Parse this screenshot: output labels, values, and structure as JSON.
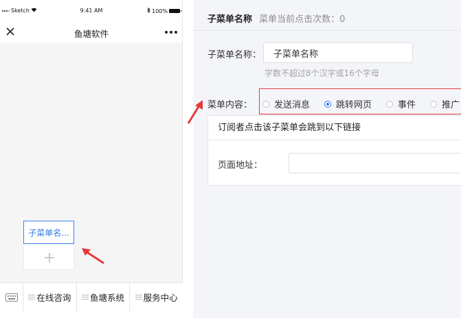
{
  "phone": {
    "status": {
      "carrier": "Sketch",
      "time": "9:41 AM",
      "battery": "100%"
    },
    "nav_title": "鱼塘软件",
    "submenu_item": "子菜单名...",
    "menus": [
      "在线咨询",
      "鱼塘系统",
      "服务中心"
    ]
  },
  "editor": {
    "header_title": "子菜单名称",
    "header_count": "菜单当前点击次数：0",
    "name_label": "子菜单名称：",
    "name_value": "子菜单名称",
    "name_hint": "字数不超过8个汉字或16个字母",
    "content_label": "菜单内容：",
    "options": [
      {
        "label": "发送消息",
        "selected": false
      },
      {
        "label": "跳转网页",
        "selected": true
      },
      {
        "label": "事件",
        "selected": false
      },
      {
        "label": "推广",
        "selected": false
      }
    ],
    "link_card_title": "订阅者点击该子菜单会跳到以下链接",
    "url_label": "页面地址：",
    "url_value": ""
  },
  "colors": {
    "accent": "#2f7ae5",
    "highlight": "#e4393c",
    "panel_bg": "#f4f5f9"
  },
  "icons": [
    "close-icon",
    "more-icon",
    "wifi-icon",
    "bluetooth-icon",
    "battery-icon",
    "keyboard-icon",
    "plus-icon",
    "menu-lines-icon",
    "annotation-arrow"
  ]
}
